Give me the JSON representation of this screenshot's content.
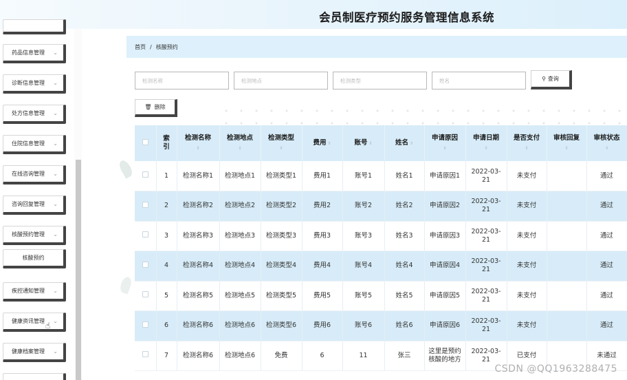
{
  "header": {
    "app_title": "会员制医疗预约服务管理信息系统"
  },
  "sidebar": {
    "items": [
      {
        "label": "药品信息管理"
      },
      {
        "label": "诊断信息管理"
      },
      {
        "label": "处方信息管理"
      },
      {
        "label": "住院信息管理"
      },
      {
        "label": "在线咨询管理"
      },
      {
        "label": "咨询回复管理"
      },
      {
        "label": "核酸预约管理"
      },
      {
        "label": "核酸预约"
      },
      {
        "label": "疾控通知管理"
      },
      {
        "label": "健康资讯管理"
      },
      {
        "label": "健康档案管理"
      }
    ]
  },
  "breadcrumb": {
    "home": "首页",
    "separator": "/",
    "current": "核酸预约"
  },
  "search": {
    "name_placeholder": "检测名称",
    "location_placeholder": "检测地点",
    "type_placeholder": "检测类型",
    "person_placeholder": "姓名",
    "query_label": "查询"
  },
  "toolbar": {
    "delete_label": "删除"
  },
  "table": {
    "headers": {
      "index": "索引",
      "name": "检测名称",
      "location": "检测地点",
      "type": "检测类型",
      "fee": "费用",
      "account": "账号",
      "person": "姓名",
      "reason": "申请原因",
      "date": "申请日期",
      "paid": "是否支付",
      "reply": "审核回复",
      "status": "审核状态"
    },
    "rows": [
      {
        "index": "1",
        "name": "检测名称1",
        "location": "检测地点1",
        "type": "检测类型1",
        "fee": "费用1",
        "account": "账号1",
        "person": "姓名1",
        "reason": "申请原因1",
        "date": "2022-03-21",
        "paid": "未支付",
        "reply": "",
        "status": "通过"
      },
      {
        "index": "2",
        "name": "检测名称2",
        "location": "检测地点2",
        "type": "检测类型2",
        "fee": "费用2",
        "account": "账号2",
        "person": "姓名2",
        "reason": "申请原因2",
        "date": "2022-03-21",
        "paid": "未支付",
        "reply": "",
        "status": "通过"
      },
      {
        "index": "3",
        "name": "检测名称3",
        "location": "检测地点3",
        "type": "检测类型3",
        "fee": "费用3",
        "account": "账号3",
        "person": "姓名3",
        "reason": "申请原因3",
        "date": "2022-03-21",
        "paid": "未支付",
        "reply": "",
        "status": "通过"
      },
      {
        "index": "4",
        "name": "检测名称4",
        "location": "检测地点4",
        "type": "检测类型4",
        "fee": "费用4",
        "account": "账号4",
        "person": "姓名4",
        "reason": "申请原因4",
        "date": "2022-03-21",
        "paid": "未支付",
        "reply": "",
        "status": "通过"
      },
      {
        "index": "5",
        "name": "检测名称5",
        "location": "检测地点5",
        "type": "检测类型5",
        "fee": "费用5",
        "account": "账号5",
        "person": "姓名5",
        "reason": "申请原因5",
        "date": "2022-03-21",
        "paid": "未支付",
        "reply": "",
        "status": "通过"
      },
      {
        "index": "6",
        "name": "检测名称6",
        "location": "检测地点6",
        "type": "检测类型6",
        "fee": "费用6",
        "account": "账号6",
        "person": "姓名6",
        "reason": "申请原因6",
        "date": "2022-03-21",
        "paid": "未支付",
        "reply": "",
        "status": "通过"
      },
      {
        "index": "7",
        "name": "检测名称6",
        "location": "检测地点6",
        "type": "免费",
        "fee": "6",
        "account": "11",
        "person": "张三",
        "reason": "这里是预约核酸的地方",
        "date": "2022-03-21",
        "paid": "已支付",
        "reply": "",
        "status": "未通过"
      }
    ]
  },
  "watermark": "CSDN @QQ1963288475",
  "colors": {
    "header_bg": "#dcf0fb",
    "row_alt_bg": "#d7ecf8",
    "button_shadow": "#444444"
  }
}
